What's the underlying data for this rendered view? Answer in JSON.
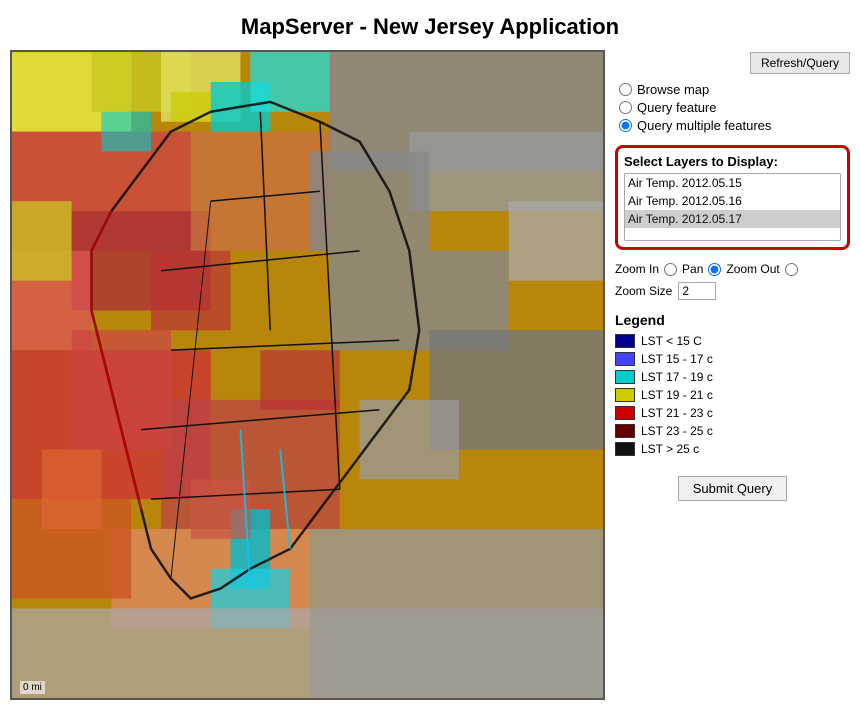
{
  "page": {
    "title": "MapServer - New Jersey Application"
  },
  "sidebar": {
    "refresh_label": "Refresh/Query",
    "radio_options": [
      {
        "id": "browse",
        "label": "Browse map",
        "checked": false
      },
      {
        "id": "query",
        "label": "Query feature",
        "checked": false
      },
      {
        "id": "query_multiple",
        "label": "Query multiple features",
        "checked": true
      }
    ],
    "select_layers_title": "Select Layers to Display:",
    "layers": [
      {
        "value": "layer1",
        "label": "Air Temp. 2012.05.15",
        "selected": false
      },
      {
        "value": "layer2",
        "label": "Air Temp. 2012.05.16",
        "selected": false
      },
      {
        "value": "layer3",
        "label": "Air Temp. 2012.05.17",
        "selected": true
      }
    ],
    "zoom_in_label": "Zoom In",
    "pan_label": "Pan",
    "zoom_out_label": "Zoom Out",
    "zoom_size_label": "Zoom Size",
    "zoom_size_value": "2",
    "legend_title": "Legend",
    "legend_items": [
      {
        "color": "#00008B",
        "label": "LST < 15 C"
      },
      {
        "color": "#4444ff",
        "label": "LST 15 - 17 c"
      },
      {
        "color": "#00cccc",
        "label": "LST 17 - 19 c"
      },
      {
        "color": "#cccc00",
        "label": "LST 19 - 21 c"
      },
      {
        "color": "#cc0000",
        "label": "LST 21 - 23 c"
      },
      {
        "color": "#660000",
        "label": "LST 23 - 25 c"
      },
      {
        "color": "#111111",
        "label": "LST > 25 c"
      }
    ],
    "submit_query_label": "Submit Query"
  },
  "map": {
    "scale_label": "0 mi"
  }
}
